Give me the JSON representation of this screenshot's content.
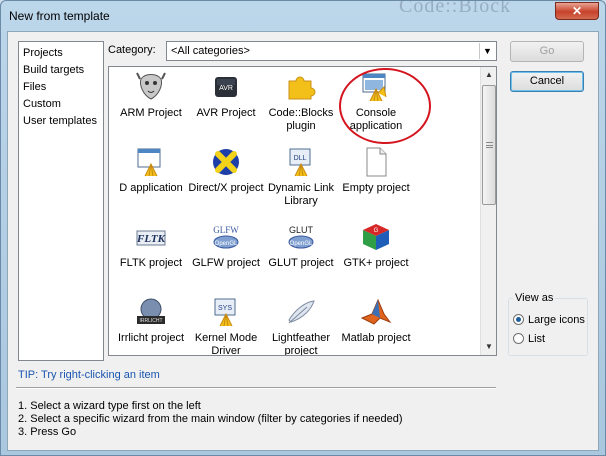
{
  "window": {
    "title": "New from template",
    "background_text": "Code::Block",
    "close_glyph": "✕"
  },
  "wizard_types": [
    "Projects",
    "Build targets",
    "Files",
    "Custom",
    "User templates"
  ],
  "category": {
    "label": "Category:",
    "value": "<All categories>"
  },
  "templates": [
    {
      "label": "ARM Project",
      "icon": "gnu-icon"
    },
    {
      "label": "AVR Project",
      "icon": "avr-chip-icon"
    },
    {
      "label": "Code::Blocks plugin",
      "icon": "puzzle-icon"
    },
    {
      "label": "Console application",
      "icon": "console-icon"
    },
    {
      "label": "D application",
      "icon": "d-app-icon"
    },
    {
      "label": "Direct/X project",
      "icon": "directx-icon"
    },
    {
      "label": "Dynamic Link Library",
      "icon": "dll-icon"
    },
    {
      "label": "Empty project",
      "icon": "blank-page-icon"
    },
    {
      "label": "FLTK project",
      "icon": "fltk-icon"
    },
    {
      "label": "GLFW project",
      "icon": "glfw-icon"
    },
    {
      "label": "GLUT project",
      "icon": "glut-icon"
    },
    {
      "label": "GTK+ project",
      "icon": "gtk-cube-icon"
    },
    {
      "label": "Irrlicht project",
      "icon": "irrlicht-icon"
    },
    {
      "label": "Kernel Mode Driver",
      "icon": "sys-driver-icon"
    },
    {
      "label": "Lightfeather project",
      "icon": "feather-icon"
    },
    {
      "label": "Matlab project",
      "icon": "matlab-icon"
    }
  ],
  "buttons": {
    "go": "Go",
    "cancel": "Cancel"
  },
  "view_as": {
    "legend": "View as",
    "options": [
      "Large icons",
      "List"
    ],
    "selected": "Large icons"
  },
  "tip": "TIP: Try right-clicking an item",
  "instructions": [
    "1. Select a wizard type first on the left",
    "2. Select a specific wizard from the main window (filter by categories if needed)",
    "3. Press Go"
  ],
  "highlight_color": "#d4141e"
}
